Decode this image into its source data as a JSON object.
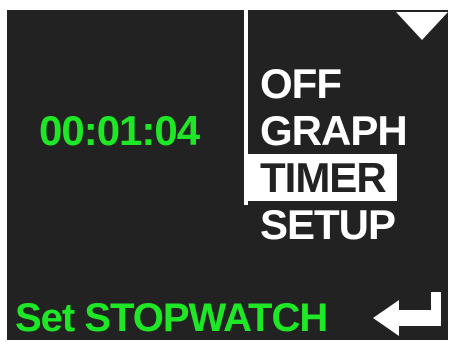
{
  "display": {
    "elapsed_time": "00:01:04"
  },
  "menu": {
    "items": [
      {
        "label": "OFF",
        "selected": false
      },
      {
        "label": "GRAPH",
        "selected": false
      },
      {
        "label": "TIMER",
        "selected": true
      },
      {
        "label": "SETUP",
        "selected": false
      }
    ]
  },
  "status": {
    "message": "Set STOPWATCH"
  },
  "icons": {
    "scroll": "triangle-down-icon",
    "enter": "enter-return-icon"
  },
  "colors": {
    "background": "#222222",
    "accent_green": "#1ee826",
    "text_white": "#ffffff"
  }
}
